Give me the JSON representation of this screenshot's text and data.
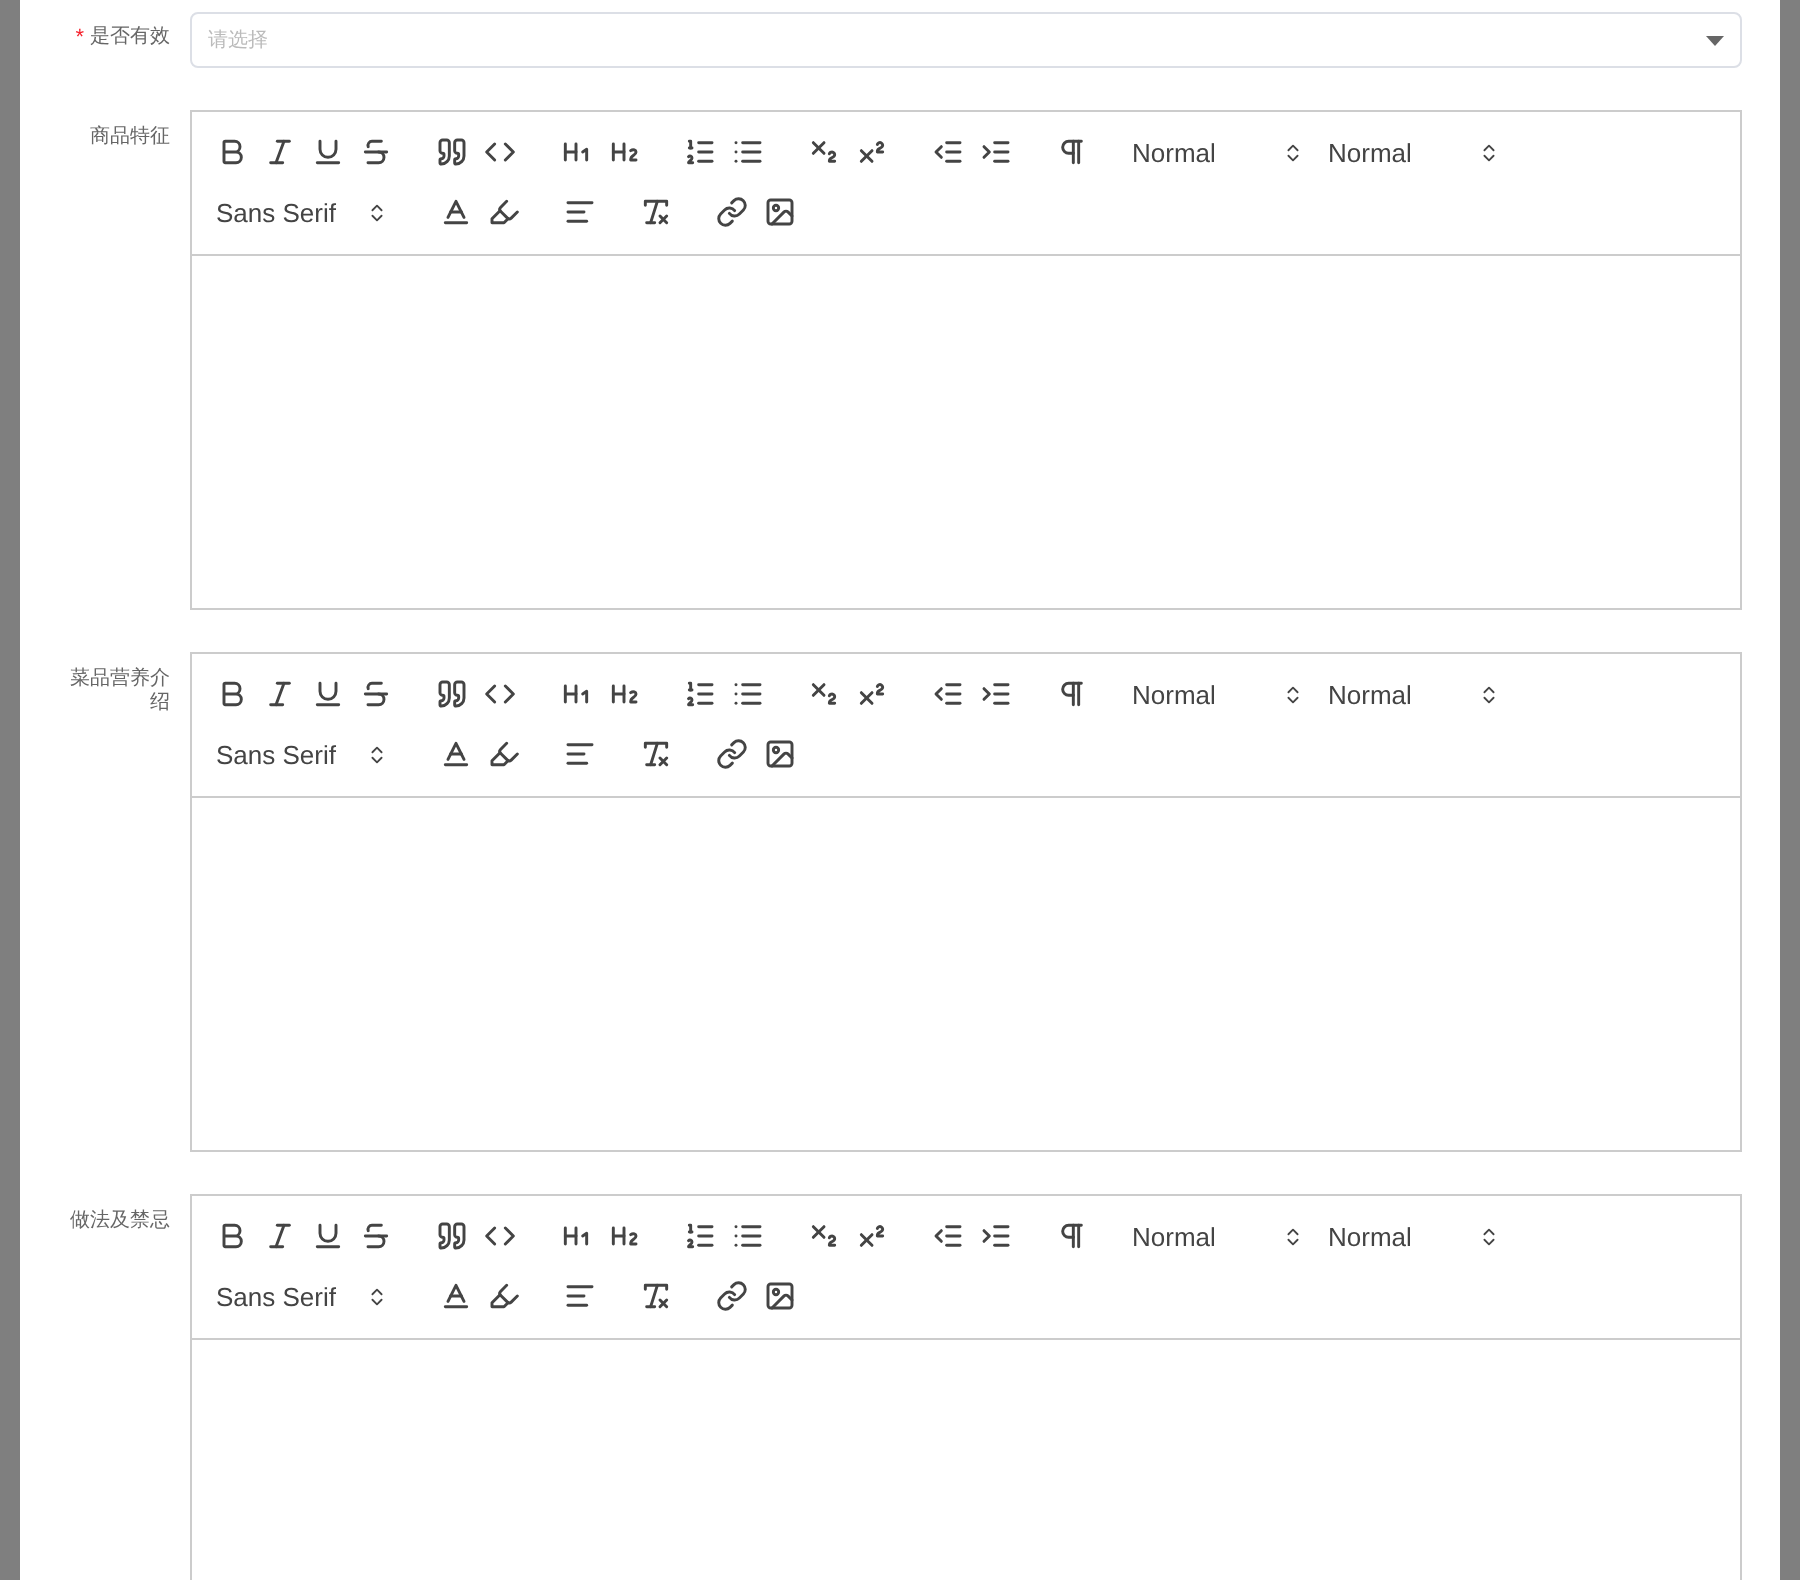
{
  "fields": [
    {
      "kind": "select",
      "label": "是否有效",
      "required_mark": "*",
      "placeholder": "请选择"
    },
    {
      "kind": "editor",
      "label": "商品特征",
      "pickers": [
        {
          "label": "Normal"
        },
        {
          "label": "Normal"
        },
        {
          "label": "Sans Serif"
        }
      ]
    },
    {
      "kind": "editor",
      "label": "菜品营养介绍",
      "pickers": [
        {
          "label": "Normal"
        },
        {
          "label": "Normal"
        },
        {
          "label": "Sans Serif"
        }
      ]
    },
    {
      "kind": "editor",
      "label": "做法及禁忌",
      "pickers": [
        {
          "label": "Normal"
        },
        {
          "label": "Normal"
        },
        {
          "label": "Sans Serif"
        }
      ]
    }
  ]
}
